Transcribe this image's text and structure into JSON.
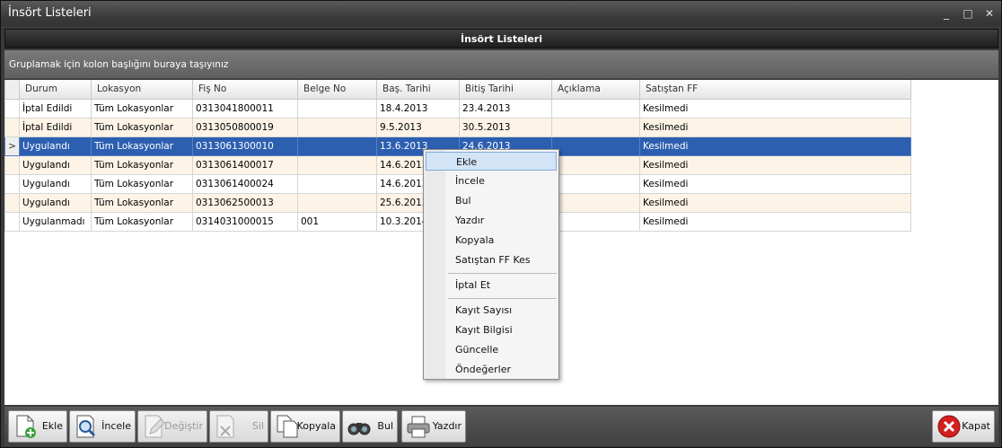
{
  "window": {
    "title": "İnsört  Listeleri",
    "controls": [
      "_",
      "□",
      "✕"
    ]
  },
  "header": {
    "title": "İnsört Listeleri"
  },
  "group_panel": {
    "text": "Gruplamak için kolon başlığını buraya taşıyınız"
  },
  "grid": {
    "columns": [
      "Durum",
      "Lokasyon",
      "Fiş No",
      "Belge No",
      "Baş. Tarihi",
      "Bitiş Tarihi",
      "Açıklama",
      "Satıştan FF"
    ],
    "rows": [
      [
        "İptal Edildi",
        "Tüm Lokasyonlar",
        "0313041800011",
        "",
        "18.4.2013",
        "23.4.2013",
        "",
        "Kesilmedi"
      ],
      [
        "İptal Edildi",
        "Tüm Lokasyonlar",
        "0313050800019",
        "",
        "9.5.2013",
        "30.5.2013",
        "",
        "Kesilmedi"
      ],
      [
        "Uygulandı",
        "Tüm Lokasyonlar",
        "0313061300010",
        "",
        "13.6.2013",
        "24.6.2013",
        "",
        "Kesilmedi"
      ],
      [
        "Uygulandı",
        "Tüm Lokasyonlar",
        "0313061400017",
        "",
        "14.6.2013",
        "",
        "",
        "Kesilmedi"
      ],
      [
        "Uygulandı",
        "Tüm Lokasyonlar",
        "0313061400024",
        "",
        "14.6.2013",
        "",
        "",
        "Kesilmedi"
      ],
      [
        "Uygulandı",
        "Tüm Lokasyonlar",
        "0313062500013",
        "",
        "25.6.2013",
        "",
        "",
        "Kesilmedi"
      ],
      [
        "Uygulanmadı",
        "Tüm Lokasyonlar",
        "0314031000015",
        "001",
        "10.3.2014",
        "",
        "",
        "Kesilmedi"
      ]
    ],
    "selected_row_indicator": ">"
  },
  "context_menu": {
    "items": [
      "Ekle",
      "İncele",
      "Bul",
      "Yazdır",
      "Kopyala",
      "Satıştan FF Kes",
      "İptal Et",
      "Kayıt Sayısı",
      "Kayıt Bilgisi",
      "Güncelle",
      "Öndeğerler"
    ]
  },
  "toolbar": {
    "ekle": "Ekle",
    "incele": "İncele",
    "degistir": "Değiştir",
    "sil": "Sil",
    "kopyala": "Kopyala",
    "bul": "Bul",
    "yazdir": "Yazdır",
    "kapat": "Kapat"
  },
  "colors": {
    "selection": "#2d5fb0",
    "alt_row": "#fdf4e7",
    "highlight": "#d4e4f7"
  }
}
